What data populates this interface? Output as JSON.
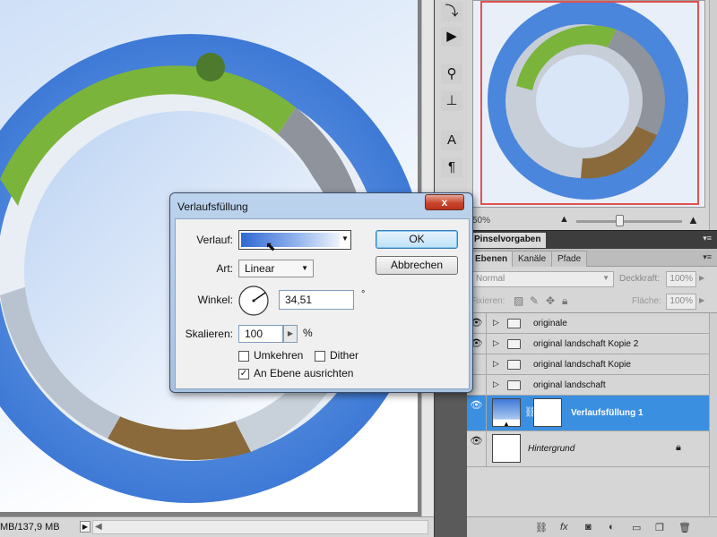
{
  "status_bar": {
    "doc_size": "MB/137,9 MB",
    "arrow_glyph": "▶"
  },
  "navigator": {
    "zoom_value": "50%",
    "zoom_out_glyph": "▲",
    "zoom_in_glyph": "▲"
  },
  "brush_panel": {
    "tab_label": "Pinselvorgaben",
    "menu_glyph": "▾≡"
  },
  "layers_panel": {
    "tabs": [
      {
        "label": "Ebenen"
      },
      {
        "label": "Kanäle"
      },
      {
        "label": "Pfade"
      }
    ],
    "menu_glyph": "▾≡",
    "blend_mode": "Normal",
    "opacity_label": "Deckkraft:",
    "opacity_value": "100%",
    "lock_label": "Fixieren:",
    "fill_label": "Fläche:",
    "fill_value": "100%",
    "layers": [
      {
        "name": "originale",
        "visible": true
      },
      {
        "name": "original landschaft Kopie 2",
        "visible": true
      },
      {
        "name": "original landschaft Kopie",
        "visible": false
      },
      {
        "name": "original landschaft",
        "visible": false
      },
      {
        "name": "Verlaufsfüllung 1",
        "visible": true,
        "selected": true
      },
      {
        "name": "Hintergrund",
        "visible": true
      }
    ],
    "footer_icons": [
      "link-icon",
      "fx-icon",
      "mask-icon",
      "adjustment-icon",
      "folder-icon",
      "new-layer-icon",
      "trash-icon"
    ]
  },
  "dialog": {
    "title": "Verlaufsfüllung",
    "close_glyph": "x",
    "verlauf_label": "Verlauf:",
    "art_label": "Art:",
    "art_value": "Linear",
    "winkel_label": "Winkel:",
    "winkel_value": "34,51",
    "degree_unit": "°",
    "skalieren_label": "Skalieren:",
    "skalieren_value": "100",
    "percent_unit": "%",
    "umkehren_label": "Umkehren",
    "umkehren_checked": false,
    "dither_label": "Dither",
    "dither_checked": false,
    "ausrichten_label": "An Ebene ausrichten",
    "ausrichten_checked": true,
    "ok_label": "OK",
    "cancel_label": "Abbrechen",
    "gradient_colors": [
      "#2f68d2",
      "#8fb2ec",
      "#eef3fb"
    ]
  },
  "colors": {
    "selection_blue": "#3b8fe0",
    "ring_blue": "#4a86dc",
    "grass_green": "#7bb43a",
    "navigator_frame": "#e25252"
  }
}
